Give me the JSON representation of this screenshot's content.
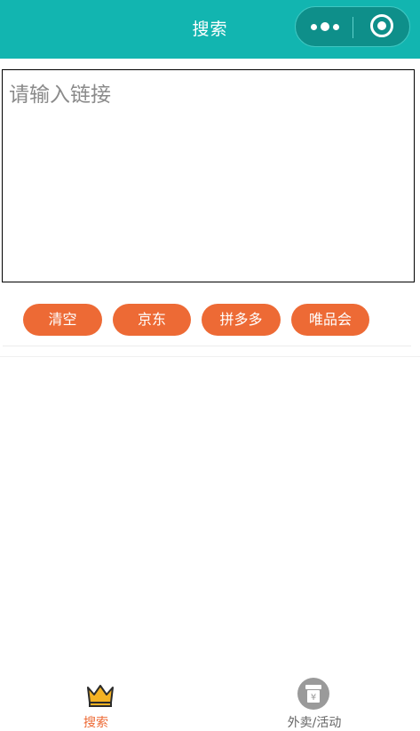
{
  "header": {
    "title": "搜索"
  },
  "capsule": {
    "more_icon": "more-dots-icon",
    "close_icon": "target-circle-icon"
  },
  "search": {
    "placeholder": "请输入链接",
    "value": ""
  },
  "actions": {
    "clear": "清空",
    "jd": "京东",
    "pdd": "拼多多",
    "vip": "唯品会"
  },
  "tabbar": {
    "items": [
      {
        "label": "搜索",
        "icon": "crown-icon",
        "active": true
      },
      {
        "label": "外卖/活动",
        "icon": "takeout-box-icon",
        "active": false
      }
    ]
  },
  "colors": {
    "header_bg": "#12b5b0",
    "accent": "#ed6a35",
    "tab_inactive": "#666666"
  }
}
